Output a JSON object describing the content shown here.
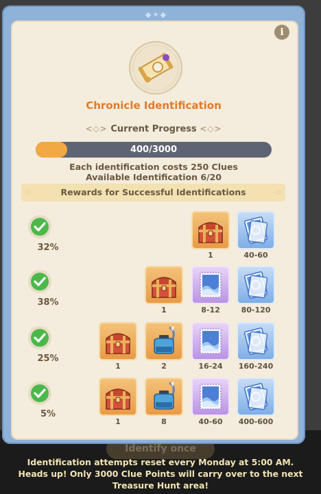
{
  "header": {
    "title": "Chronicle Identification",
    "info_icon": "info-icon",
    "emblem_icon": "treasure-map-scroll-icon"
  },
  "progress": {
    "heading": "Current Progress",
    "text": "400/3000",
    "fraction": 0.133
  },
  "cost": {
    "line1": "Each identification costs 250 Clues",
    "line2": "Available Identification 6/20"
  },
  "rewards": {
    "heading": "Rewards for Successful Identifications",
    "tiers": [
      {
        "chance": "32%",
        "items": [
          {
            "icon": "treasure-chest-icon",
            "rarity": "orange",
            "qty": "1"
          },
          {
            "icon": "blue-ticket-icon",
            "rarity": "blue",
            "qty": "40-60"
          }
        ]
      },
      {
        "chance": "38%",
        "items": [
          {
            "icon": "treasure-chest-icon",
            "rarity": "orange",
            "qty": "1"
          },
          {
            "icon": "wave-stamp-card-icon",
            "rarity": "purple",
            "qty": "8-12"
          },
          {
            "icon": "blue-ticket-icon",
            "rarity": "blue",
            "qty": "80-120"
          }
        ]
      },
      {
        "chance": "25%",
        "items": [
          {
            "icon": "treasure-chest-icon",
            "rarity": "orange",
            "qty": "1"
          },
          {
            "icon": "ink-bottle-icon",
            "rarity": "orange",
            "qty": "2"
          },
          {
            "icon": "wave-stamp-card-icon",
            "rarity": "purple",
            "qty": "16-24"
          },
          {
            "icon": "blue-ticket-icon",
            "rarity": "blue",
            "qty": "160-240"
          }
        ]
      },
      {
        "chance": "5%",
        "items": [
          {
            "icon": "treasure-chest-icon",
            "rarity": "orange",
            "qty": "1"
          },
          {
            "icon": "ink-bottle-icon",
            "rarity": "orange",
            "qty": "8"
          },
          {
            "icon": "wave-stamp-card-icon",
            "rarity": "purple",
            "qty": "40-60"
          },
          {
            "icon": "blue-ticket-icon",
            "rarity": "blue",
            "qty": "400-600"
          }
        ]
      }
    ]
  },
  "action": {
    "identify_label": "Identify once"
  },
  "footer": {
    "line1": "Identification attempts reset every Monday at 5:00 AM.",
    "line2": "Heads up! Only 3000 Clue Points will carry over to the next",
    "line3": "Treasure Hunt area!"
  },
  "colors": {
    "title": "#e07b2a",
    "bar_fill": "#f2a843",
    "bar_track": "#5e6473",
    "check": "#4cb84a",
    "frame": "#8fb2d9",
    "panel": "#f4ecdc"
  }
}
